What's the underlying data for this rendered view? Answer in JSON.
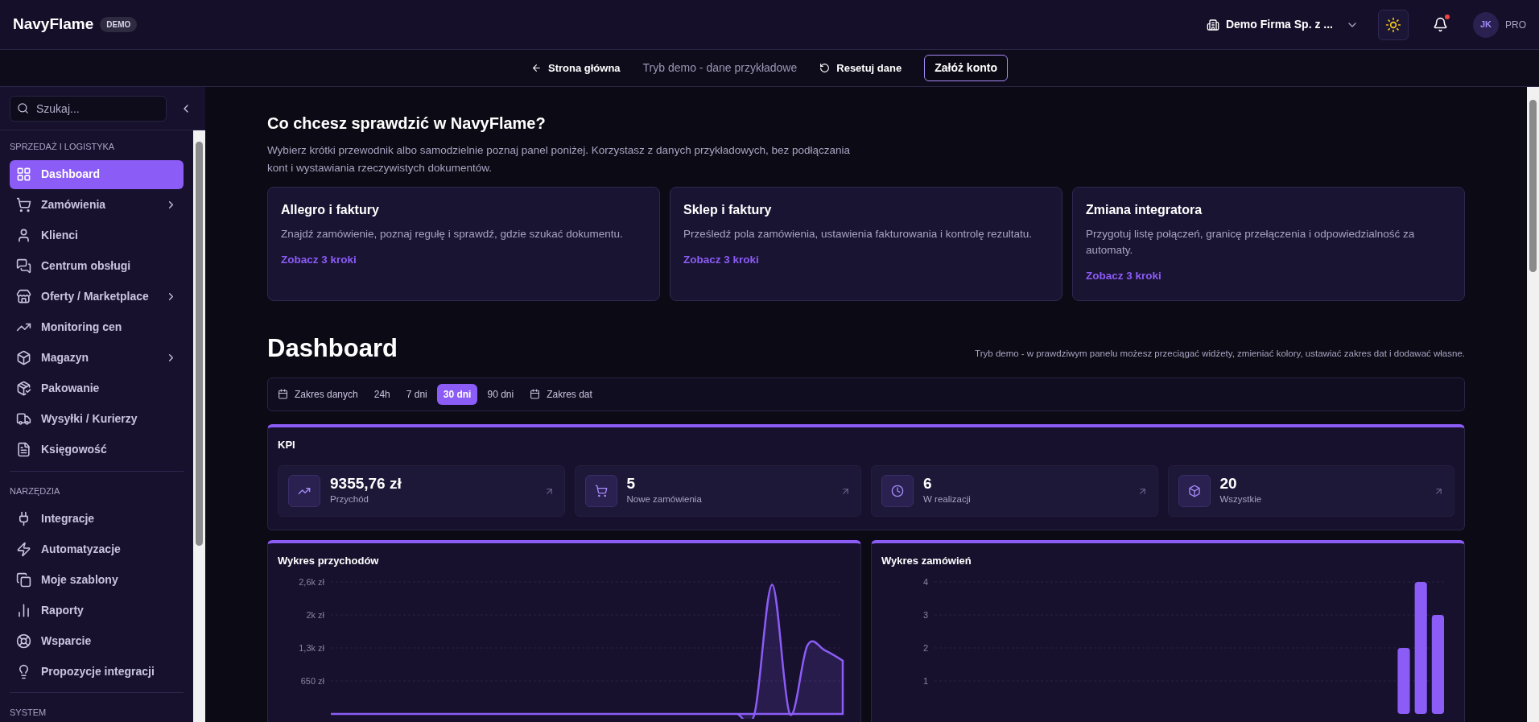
{
  "header": {
    "logo": "NavyFlame",
    "badge": "DEMO",
    "company": "Demo Firma Sp. z ...",
    "notifications_unread": true,
    "avatar": "JK",
    "plan": "PRO"
  },
  "demo_bar": {
    "back": "Strona główna",
    "info": "Tryb demo - dane przykładowe",
    "reset": "Resetuj dane",
    "signup": "Załóż konto"
  },
  "sidebar": {
    "search_placeholder": "Szukaj...",
    "sections": [
      {
        "title": "SPRZEDAŻ I LOGISTYKA",
        "items": [
          {
            "label": "Dashboard",
            "selected": true,
            "submenu": false
          },
          {
            "label": "Zamówienia",
            "selected": false,
            "submenu": true
          },
          {
            "label": "Klienci",
            "selected": false,
            "submenu": false
          },
          {
            "label": "Centrum obsługi",
            "selected": false,
            "submenu": false
          },
          {
            "label": "Oferty / Marketplace",
            "selected": false,
            "submenu": true
          },
          {
            "label": "Monitoring cen",
            "selected": false,
            "submenu": false
          },
          {
            "label": "Magazyn",
            "selected": false,
            "submenu": true
          },
          {
            "label": "Pakowanie",
            "selected": false,
            "submenu": false
          },
          {
            "label": "Wysyłki / Kurierzy",
            "selected": false,
            "submenu": false
          },
          {
            "label": "Księgowość",
            "selected": false,
            "submenu": false
          }
        ]
      },
      {
        "title": "NARZĘDZIA",
        "items": [
          {
            "label": "Integracje",
            "selected": false,
            "submenu": false
          },
          {
            "label": "Automatyzacje",
            "selected": false,
            "submenu": false
          },
          {
            "label": "Moje szablony",
            "selected": false,
            "submenu": false
          },
          {
            "label": "Raporty",
            "selected": false,
            "submenu": false
          },
          {
            "label": "Wsparcie",
            "selected": false,
            "submenu": false
          },
          {
            "label": "Propozycje integracji",
            "selected": false,
            "submenu": false
          }
        ]
      },
      {
        "title": "SYSTEM"
      }
    ]
  },
  "intro": {
    "title": "Co chcesz sprawdzić w NavyFlame?",
    "description": "Wybierz krótki przewodnik albo samodzielnie poznaj panel poniżej. Korzystasz z danych przykładowych, bez podłączania kont i wystawiania rzeczywistych dokumentów.",
    "cards": [
      {
        "title": "Allegro i faktury",
        "text": "Znajdź zamówienie, poznaj regułę i sprawdź, gdzie szukać dokumentu.",
        "link": "Zobacz 3 kroki"
      },
      {
        "title": "Sklep i faktury",
        "text": "Prześledź pola zamówienia, ustawienia fakturowania i kontrolę rezultatu.",
        "link": "Zobacz 3 kroki"
      },
      {
        "title": "Zmiana integratora",
        "text": "Przygotuj listę połączeń, granicę przełączenia i odpowiedzialność za automaty.",
        "link": "Zobacz 3 kroki"
      }
    ]
  },
  "dashboard": {
    "title": "Dashboard",
    "hint": "Tryb demo - w prawdziwym panelu możesz przeciągać widżety, zmieniać kolory, ustawiać zakres dat i dodawać własne.",
    "range_label": "Zakres danych",
    "ranges": [
      {
        "label": "24h",
        "selected": false
      },
      {
        "label": "7 dni",
        "selected": false
      },
      {
        "label": "30 dni",
        "selected": true
      },
      {
        "label": "90 dni",
        "selected": false
      }
    ],
    "date_range": "Zakres dat",
    "kpi": {
      "title": "KPI",
      "items": [
        {
          "value": "9355,76 zł",
          "label": "Przychód"
        },
        {
          "value": "5",
          "label": "Nowe zamówienia"
        },
        {
          "value": "6",
          "label": "W realizacji"
        },
        {
          "value": "20",
          "label": "Wszystkie"
        }
      ]
    },
    "revenue_chart": {
      "title": "Wykres przychodów",
      "chart_data": {
        "type": "area",
        "grid": true,
        "ylim": [
          0,
          2600
        ],
        "yticks": [
          {
            "value": 650,
            "label": "650 zł"
          },
          {
            "value": 1300,
            "label": "1,3k zł"
          },
          {
            "value": 1950,
            "label": "2k zł"
          },
          {
            "value": 2600,
            "label": "2,6k zł"
          }
        ],
        "series": [
          {
            "color": "#8b5cf6",
            "values": [
              0,
              0,
              0,
              0,
              0,
              0,
              0,
              0,
              0,
              0,
              0,
              0,
              0,
              0,
              0,
              0,
              0,
              0,
              0,
              0,
              0,
              0,
              0,
              0,
              0,
              2550,
              0,
              1350,
              1250,
              1050
            ]
          }
        ]
      }
    },
    "orders_chart": {
      "title": "Wykres zamówień",
      "chart_data": {
        "type": "bar",
        "grid": true,
        "ylim": [
          0,
          4
        ],
        "yticks": [
          1,
          2,
          3,
          4
        ],
        "series": [
          {
            "color": "#8b5cf6",
            "values": [
              0,
              0,
              0,
              0,
              0,
              0,
              0,
              0,
              0,
              0,
              0,
              0,
              0,
              0,
              0,
              0,
              0,
              0,
              0,
              0,
              0,
              0,
              0,
              0,
              0,
              0,
              0,
              2,
              4,
              3
            ]
          }
        ]
      }
    }
  }
}
